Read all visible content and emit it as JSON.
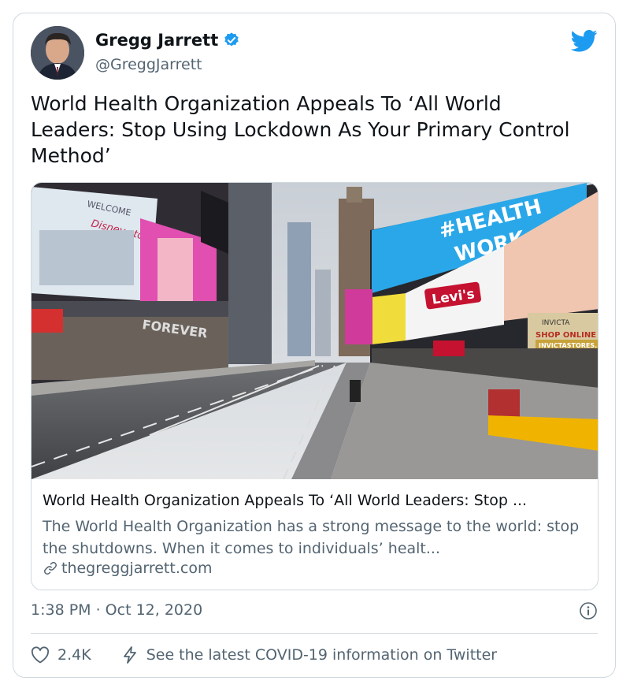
{
  "author": {
    "name": "Gregg Jarrett",
    "handle": "@GreggJarrett",
    "verified_icon": "verified-badge-icon"
  },
  "tweet": {
    "text": "World Health Organization Appeals To ‘All World Leaders: Stop Using Lockdown As Your Primary Control Method’",
    "timestamp": "1:38 PM · Oct 12, 2020"
  },
  "link_card": {
    "title": "World Health Organization Appeals To ‘All World Leaders: Stop ...",
    "description": "The World Health Organization has a strong message to the world: stop the shutdowns. When it comes to individuals’ healt...",
    "domain": "thegreggjarrett.com"
  },
  "photo": {
    "signs": {
      "welcome": "WELCOME",
      "disney": "Disney store",
      "forever": "FOREVER",
      "levis": "Levi's",
      "health": "#HEALTH",
      "work": "WORK",
      "invicta": "INVICTA",
      "shop": "SHOP ONLINE",
      "invicta_url": "INVICTASTORES."
    }
  },
  "actions": {
    "likes": "2.4K",
    "covid_label": "See the latest COVID-19 information on Twitter"
  },
  "colors": {
    "twitter_blue": "#1d9bf0",
    "text_secondary": "#536471",
    "border": "#cfd9de",
    "levis_red": "#c41230"
  }
}
